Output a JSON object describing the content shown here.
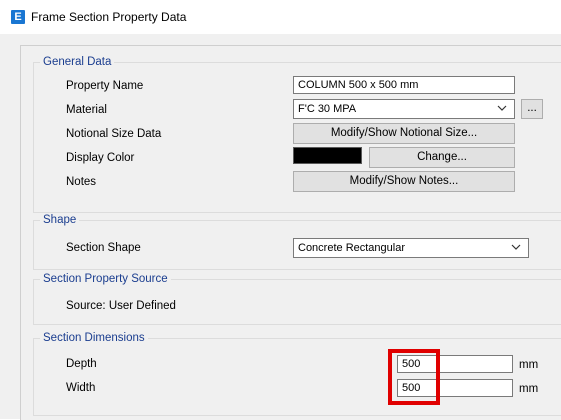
{
  "window": {
    "app_icon_letter": "E",
    "title": "Frame Section Property Data"
  },
  "general_data": {
    "group_title": "General Data",
    "property_name_label": "Property Name",
    "property_name_value": "COLUMN 500 x 500 mm",
    "material_label": "Material",
    "material_value": "F'C 30 MPA",
    "material_more_button": "...",
    "notional_size_label": "Notional Size Data",
    "notional_size_button": "Modify/Show Notional Size...",
    "display_color_label": "Display Color",
    "display_color_value": "#000000",
    "change_button": "Change...",
    "notes_label": "Notes",
    "notes_button": "Modify/Show Notes..."
  },
  "shape": {
    "group_title": "Shape",
    "section_shape_label": "Section Shape",
    "section_shape_value": "Concrete Rectangular"
  },
  "section_property_source": {
    "group_title": "Section Property Source",
    "source_text": "Source:  User Defined"
  },
  "section_dimensions": {
    "group_title": "Section Dimensions",
    "depth_label": "Depth",
    "depth_value": "500",
    "depth_unit": "mm",
    "width_label": "Width",
    "width_value": "500",
    "width_unit": "mm",
    "highlight_color": "#e00000"
  }
}
